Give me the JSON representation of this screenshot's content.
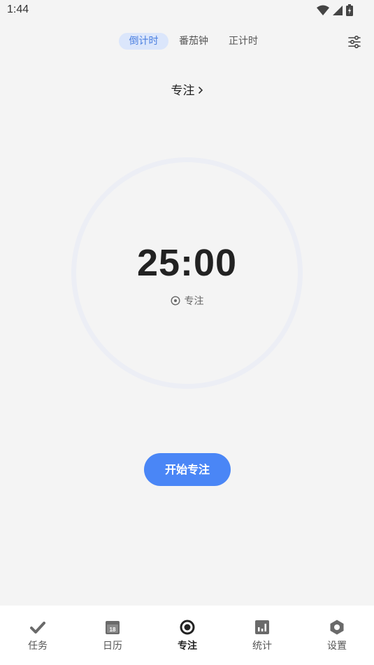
{
  "status_bar": {
    "time": "1:44"
  },
  "tabs": [
    {
      "label": "倒计时",
      "active": true
    },
    {
      "label": "番茄钟",
      "active": false
    },
    {
      "label": "正计时",
      "active": false
    }
  ],
  "mode": {
    "label": "专注"
  },
  "timer": {
    "display": "25:00",
    "label": "专注"
  },
  "start_button": {
    "label": "开始专注"
  },
  "bottom_nav": [
    {
      "label": "任务",
      "icon": "check-icon",
      "active": false
    },
    {
      "label": "日历",
      "icon": "calendar-icon",
      "calendar_day": "18",
      "active": false
    },
    {
      "label": "专注",
      "icon": "focus-target-icon",
      "active": true
    },
    {
      "label": "统计",
      "icon": "bar-chart-icon",
      "active": false
    },
    {
      "label": "设置",
      "icon": "settings-hexagon-icon",
      "active": false
    }
  ],
  "colors": {
    "background": "#f4f4f4",
    "accent": "#4a86f6",
    "tab_active_bg": "#dbe6fb",
    "tab_active_text": "#4a7fe0",
    "ring": "#eceef5"
  }
}
